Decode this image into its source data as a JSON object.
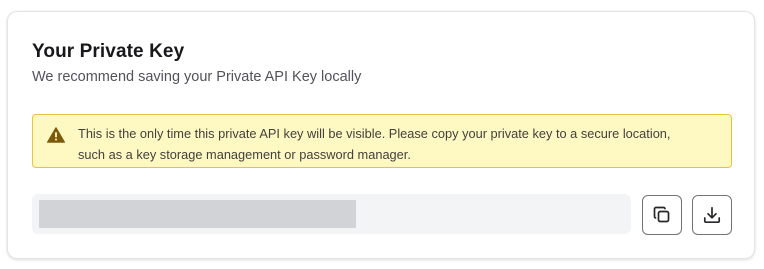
{
  "card": {
    "title": "Your Private Key",
    "subtitle": "We recommend saving your Private API Key locally"
  },
  "alert": {
    "icon": "warning-triangle-icon",
    "text": "This is the only time this private API key will be visible. Please copy your private key to a secure location, such as a key storage management or password manager."
  },
  "key_field": {
    "value": ""
  },
  "actions": {
    "copy_icon": "copy-icon",
    "download_icon": "download-icon"
  },
  "colors": {
    "alert_background": "#fef9c3",
    "alert_border": "#e8c33f",
    "alert_icon": "#7c5a0b",
    "field_background": "#f2f4f5",
    "masked_value": "#d1d3d6"
  }
}
